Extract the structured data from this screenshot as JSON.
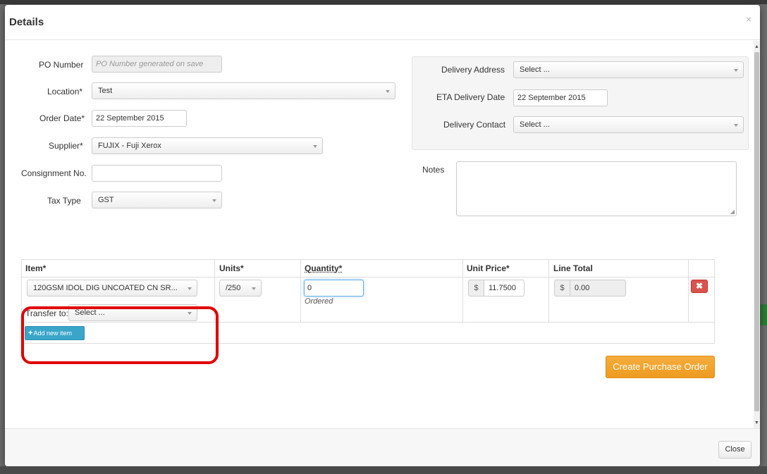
{
  "modal": {
    "title": "Details",
    "close_glyph": "×"
  },
  "form": {
    "po_number_label": "PO Number",
    "po_number_placeholder": "PO Number generated on save",
    "location_label": "Location*",
    "location_value": "Test",
    "order_date_label": "Order Date*",
    "order_date_value": "22 September 2015",
    "supplier_label": "Supplier*",
    "supplier_value": "FUJIX - Fuji Xerox",
    "consignment_label": "Consignment No.",
    "consignment_value": "",
    "tax_type_label": "Tax Type",
    "tax_type_value": "GST"
  },
  "delivery": {
    "address_label": "Delivery Address",
    "address_value": "Select ...",
    "eta_label": "ETA Delivery Date",
    "eta_value": "22 September 2015",
    "contact_label": "Delivery Contact",
    "contact_value": "Select ..."
  },
  "notes": {
    "label": "Notes",
    "value": ""
  },
  "items_table": {
    "headers": {
      "item": "Item*",
      "units": "Units*",
      "quantity": "Quantity*",
      "unit_price": "Unit Price*",
      "line_total": "Line Total"
    },
    "rows": [
      {
        "item": "120GSM IDOL DIG UNCOATED CN SR...",
        "transfer_label": "Transfer to:",
        "transfer_value": "Select ...",
        "units": "/250",
        "quantity": "0",
        "quantity_note": "Ordered",
        "currency": "$",
        "unit_price": "11.7500",
        "line_total": "0.00",
        "delete_glyph": "✖"
      }
    ],
    "add_button_label": "Add new item",
    "add_button_glyph": "+"
  },
  "actions": {
    "create_label": "Create Purchase Order",
    "close_label": "Close"
  },
  "colors": {
    "primary_action": "#f0a030",
    "danger": "#d9534f",
    "info": "#39a6c9",
    "highlight": "#e00000"
  }
}
